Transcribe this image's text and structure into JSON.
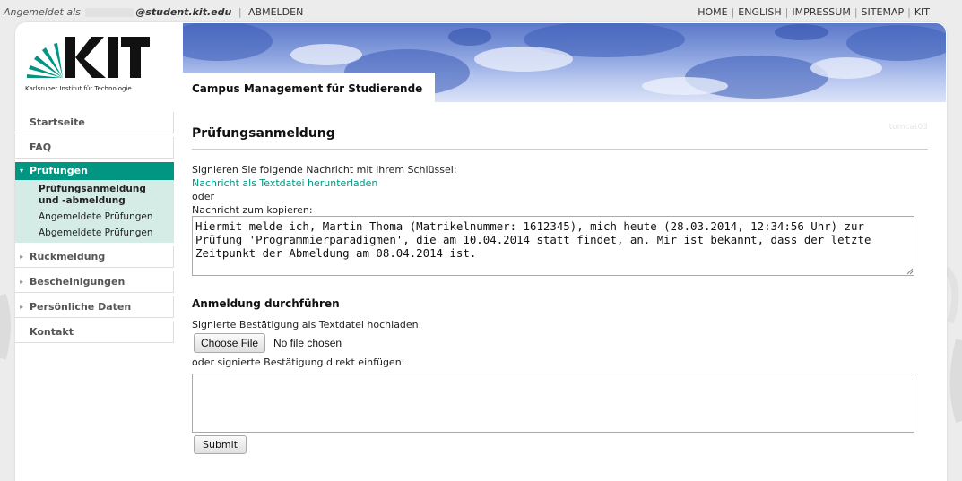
{
  "topbar": {
    "login_prefix": "Angemeldet als",
    "email_suffix": "@student.kit.edu",
    "logout": "ABMELDEN",
    "nav": [
      "HOME",
      "ENGLISH",
      "IMPRESSUM",
      "SITEMAP",
      "KIT"
    ]
  },
  "logo": {
    "caption": "Karlsruher Institut für Technologie"
  },
  "banner": {
    "title": "Campus Management für Studierende"
  },
  "sidebar": {
    "items": [
      {
        "label": "Startseite"
      },
      {
        "label": "FAQ"
      },
      {
        "label": "Prüfungen"
      },
      {
        "label": "Rückmeldung"
      },
      {
        "label": "Bescheinigungen"
      },
      {
        "label": "Persönliche Daten"
      },
      {
        "label": "Kontakt"
      }
    ],
    "sub_items": [
      {
        "label": "Prüfungsanmeldung und -abmeldung"
      },
      {
        "label": "Angemeldete Prüfungen"
      },
      {
        "label": "Abgemeldete Prüfungen"
      }
    ]
  },
  "main": {
    "ghost": "tomcat03",
    "title": "Prüfungsanmeldung",
    "sign_prompt": "Signieren Sie folgende Nachricht mit ihrem Schlüssel:",
    "download_link": "Nachricht als Textdatei herunterladen",
    "or": "oder",
    "copy_prompt": "Nachricht zum kopieren:",
    "message": "Hiermit melde ich, Martin Thoma (Matrikelnummer: 1612345), mich heute (28.03.2014, 12:34:56 Uhr) zur Prüfung 'Programmierparadigmen', die am 10.04.2014 statt findet, an. Mir ist bekannt, dass der letzte Zeitpunkt der Abmeldung am 08.04.2014 ist.",
    "section_title": "Anmeldung durchführen",
    "upload_prompt": "Signierte Bestätigung als Textdatei hochladen:",
    "choose_file": "Choose File",
    "no_file": "No file chosen",
    "paste_prompt": "oder signierte Bestätigung direkt einfügen:",
    "paste_value": "",
    "submit": "Submit"
  },
  "colors": {
    "accent": "#009682",
    "accent_light": "#d4ebe6"
  }
}
